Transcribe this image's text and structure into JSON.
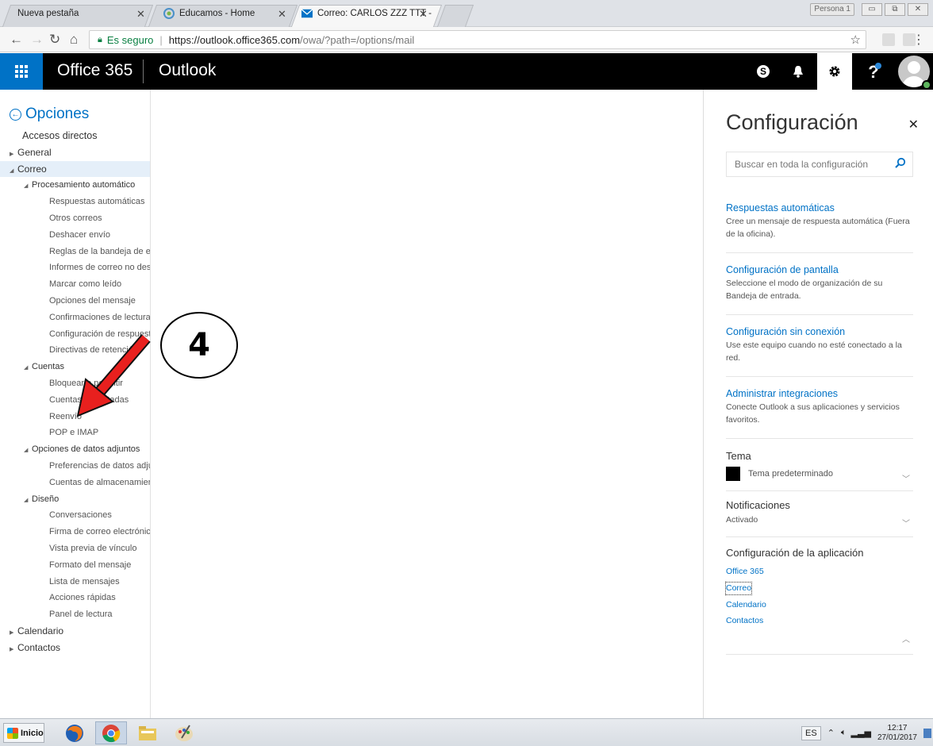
{
  "browser": {
    "tabs": [
      {
        "label": "Nueva pestaña",
        "icon": "blank-page-icon"
      },
      {
        "label": "Educamos - Home",
        "icon": "educamos-icon"
      },
      {
        "label": "Correo: CARLOS ZZZ TTT -",
        "icon": "mail-icon"
      }
    ],
    "persona": "Persona 1",
    "secure_label": "Es seguro",
    "url_host": "https://outlook.office365.com",
    "url_path": "/owa/?path=/options/mail"
  },
  "header": {
    "brand": "Office 365",
    "app": "Outlook"
  },
  "leftnav": {
    "back_label": "Opciones",
    "items": [
      {
        "label": "Accesos directos",
        "level": 0
      },
      {
        "label": "General",
        "level": 0,
        "expander": "collapsed"
      },
      {
        "label": "Correo",
        "level": 0,
        "expander": "expanded",
        "selected": true
      },
      {
        "label": "Procesamiento automático",
        "level": 1,
        "expander": "expanded"
      },
      {
        "label": "Respuestas automáticas",
        "level": 2
      },
      {
        "label": "Otros correos",
        "level": 2
      },
      {
        "label": "Deshacer envío",
        "level": 2
      },
      {
        "label": "Reglas de la bandeja de en",
        "level": 2
      },
      {
        "label": "Informes de correo no des",
        "level": 2
      },
      {
        "label": "Marcar como leído",
        "level": 2
      },
      {
        "label": "Opciones del mensaje",
        "level": 2
      },
      {
        "label": "Confirmaciones de lectura",
        "level": 2
      },
      {
        "label": "Configuración de respuest",
        "level": 2
      },
      {
        "label": "Directivas de retención",
        "level": 2
      },
      {
        "label": "Cuentas",
        "level": 1,
        "expander": "expanded"
      },
      {
        "label": "Bloquear o permitir",
        "level": 2
      },
      {
        "label": "Cuentas conectadas",
        "level": 2
      },
      {
        "label": "Reenvío",
        "level": 2
      },
      {
        "label": "POP e IMAP",
        "level": 2
      },
      {
        "label": "Opciones de datos adjuntos",
        "level": 1,
        "expander": "expanded"
      },
      {
        "label": "Preferencias de datos adju",
        "level": 2
      },
      {
        "label": "Cuentas de almacenamien",
        "level": 2
      },
      {
        "label": "Diseño",
        "level": 1,
        "expander": "expanded"
      },
      {
        "label": "Conversaciones",
        "level": 2
      },
      {
        "label": "Firma de correo electrónic",
        "level": 2
      },
      {
        "label": "Vista previa de vínculo",
        "level": 2
      },
      {
        "label": "Formato del mensaje",
        "level": 2
      },
      {
        "label": "Lista de mensajes",
        "level": 2
      },
      {
        "label": "Acciones rápidas",
        "level": 2
      },
      {
        "label": "Panel de lectura",
        "level": 2
      },
      {
        "label": "Calendario",
        "level": 0,
        "expander": "collapsed"
      },
      {
        "label": "Contactos",
        "level": 0,
        "expander": "collapsed"
      }
    ]
  },
  "annotation": {
    "step_number": "4"
  },
  "settings": {
    "title": "Configuración",
    "search_placeholder": "Buscar en toda la configuración",
    "sections": [
      {
        "link": "Respuestas automáticas",
        "desc": "Cree un mensaje de respuesta automática (Fuera de la oficina)."
      },
      {
        "link": "Configuración de pantalla",
        "desc": "Seleccione el modo de organización de su Bandeja de entrada."
      },
      {
        "link": "Configuración sin conexión",
        "desc": "Use este equipo cuando no esté conectado a la red."
      },
      {
        "link": "Administrar integraciones",
        "desc": "Conecte Outlook a sus aplicaciones y servicios favoritos."
      }
    ],
    "theme_label": "Tema",
    "theme_value": "Tema predeterminado",
    "notifications_label": "Notificaciones",
    "notifications_value": "Activado",
    "app_settings_label": "Configuración de la aplicación",
    "app_links": [
      "Office 365",
      "Correo",
      "Calendario",
      "Contactos"
    ]
  },
  "taskbar": {
    "start_label": "Inicio",
    "lang": "ES",
    "time": "12:17",
    "date": "27/01/2017"
  },
  "colors": {
    "accent": "#0072c6",
    "header_bg": "#000000",
    "selected_nav": "#e5eff9",
    "arrow": "#e8201e"
  }
}
